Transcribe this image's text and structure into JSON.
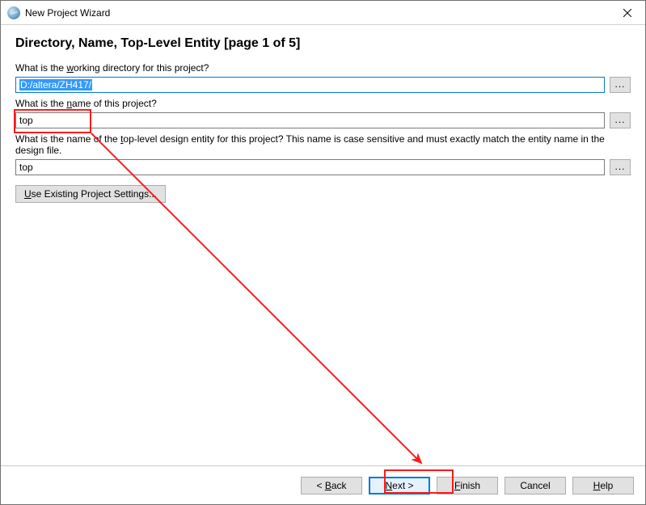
{
  "window": {
    "title": "New Project Wizard"
  },
  "page": {
    "heading": "Directory, Name, Top-Level Entity [page 1 of 5]"
  },
  "fields": {
    "working_dir": {
      "label_pre": "What is the ",
      "label_u": "w",
      "label_post": "orking directory for this project?",
      "value": "D:/altera/ZH417/"
    },
    "project_name": {
      "label_pre": "What is the ",
      "label_u": "n",
      "label_post": "ame of this project?",
      "value": "top"
    },
    "top_entity": {
      "label_pre": "What is the name of the ",
      "label_u": "t",
      "label_post": "op-level design entity for this project? This name is case sensitive and must exactly match the entity name in the design file.",
      "value": "top"
    }
  },
  "buttons": {
    "use_existing_pre": "",
    "use_existing_u": "U",
    "use_existing_post": "se Existing Project Settings...",
    "browse": "...",
    "back_lt": "< ",
    "back_u": "B",
    "back_post": "ack",
    "next_u": "N",
    "next_post": "ext >",
    "finish_u": "F",
    "finish_post": "inish",
    "cancel": "Cancel",
    "help_u": "H",
    "help_post": "elp"
  }
}
